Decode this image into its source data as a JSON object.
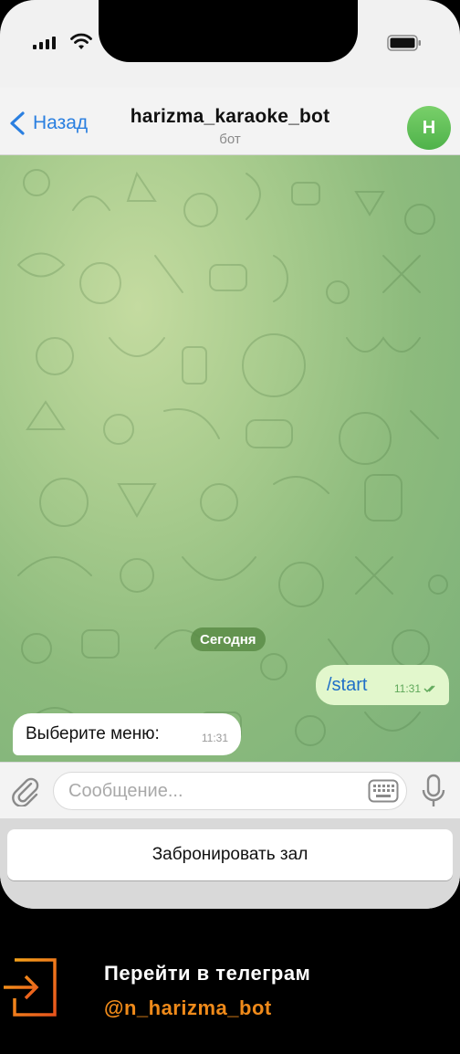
{
  "nav": {
    "back_label": "Назад",
    "title": "harizma_karaoke_bot",
    "subtitle": "бот",
    "avatar_letter": "H"
  },
  "chat": {
    "date_label": "Сегодня",
    "messages": [
      {
        "direction": "outgoing",
        "text": "/start",
        "time": "11:31",
        "status": "read"
      },
      {
        "direction": "incoming",
        "text": "Выберите меню:",
        "time": "11:31"
      }
    ]
  },
  "input": {
    "placeholder": "Сообщение..."
  },
  "keyboard": {
    "buttons": [
      {
        "label": "Забронировать зал"
      }
    ]
  },
  "footer": {
    "line1": "Перейти в телеграм",
    "line2": "@n_harizma_bot"
  },
  "colors": {
    "accent": "#2a7fe0",
    "outgoing_bubble": "#e2f7cc",
    "footer_handle": "#ef8a1a",
    "avatar": "#5cbf52"
  },
  "icons": [
    "signal-icon",
    "wifi-icon",
    "battery-icon",
    "back-chevron-icon",
    "attach-icon",
    "keyboard-icon",
    "microphone-icon",
    "read-check-icon",
    "enter-logo-icon"
  ]
}
